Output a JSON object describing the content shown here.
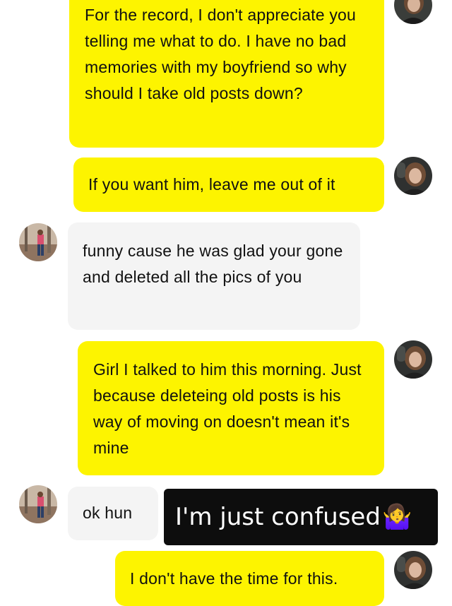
{
  "messages": [
    {
      "sender": "me",
      "text": "For the record, I don't appreciate you telling me what to do. I have no bad memories with my boyfriend so why should I take old posts down?"
    },
    {
      "sender": "me",
      "text": "If you want him, leave me out of it"
    },
    {
      "sender": "them",
      "text": "funny cause he was glad your gone and deleted all the pics of you"
    },
    {
      "sender": "me",
      "text": "Girl I talked to him this morning. Just because deleteing old posts is his way of moving on doesn't mean it's mine"
    },
    {
      "sender": "them",
      "text": "ok hun"
    },
    {
      "sender": "me",
      "text": "I don't have the time for this."
    }
  ],
  "caption_overlay": {
    "text": "I'm just confused",
    "emoji": "🤷‍♀️"
  },
  "colors": {
    "me_bubble": "#fdf400",
    "them_bubble": "#f4f4f4",
    "overlay_bg": "#0d0d0d"
  }
}
